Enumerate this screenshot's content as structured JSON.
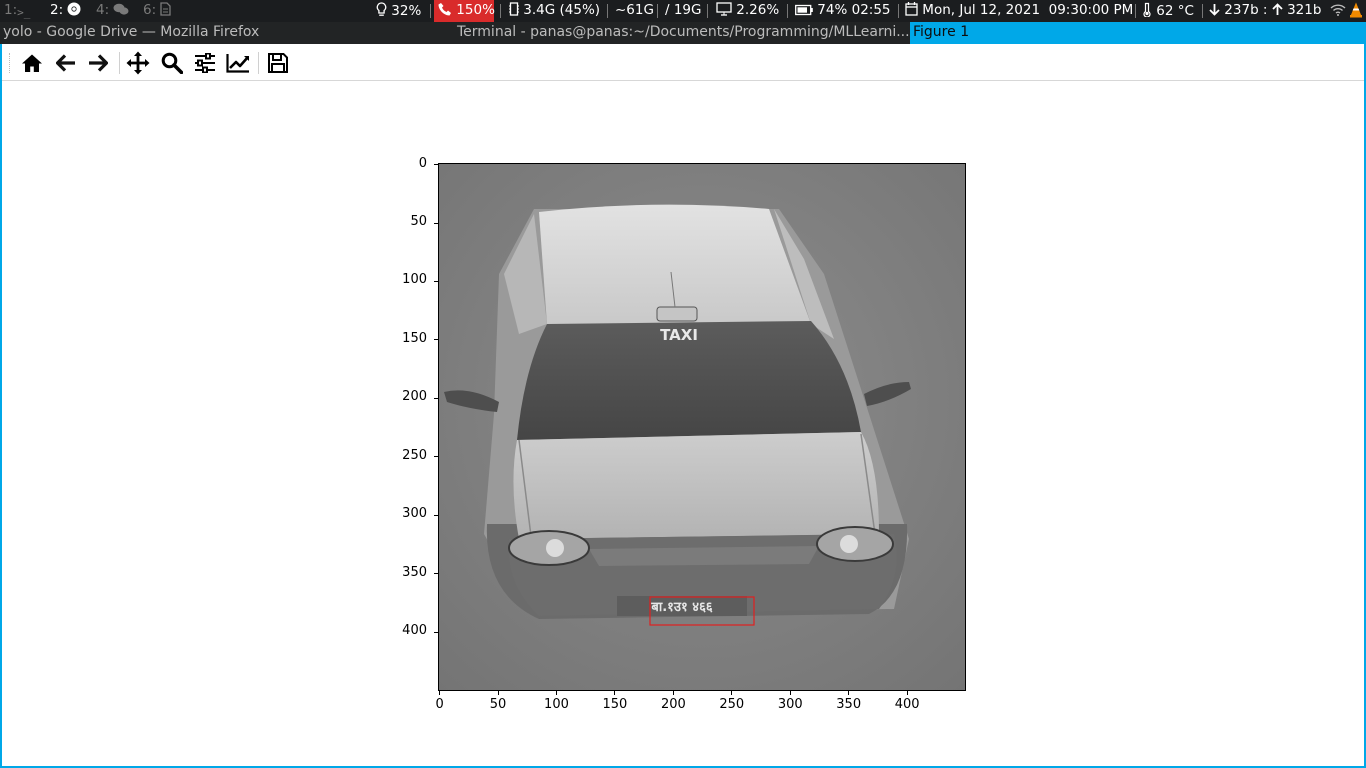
{
  "statusbar": {
    "workspaces": [
      {
        "label": "1:",
        "icon": "terminal-icon",
        "active": false
      },
      {
        "label": "2:",
        "icon": "chrome-icon",
        "active": true
      },
      {
        "label": "4:",
        "icon": "chat-icon",
        "active": false
      },
      {
        "label": "6:",
        "icon": "document-icon",
        "active": false
      }
    ],
    "brightness": "32%",
    "volume": "150%",
    "memory": "3.4G (45%)",
    "disk_used": "~61G",
    "disk_free": "/ 19G",
    "cpu": "2.26%",
    "battery_pct": "74%",
    "battery_time": "02:55",
    "datetime": "Mon, Jul 12, 2021  09:30:00 PM",
    "temperature": "62 °C",
    "net_down": "237b :",
    "net_up": "321b",
    "colors": {
      "background": "#1b1d1f",
      "alert": "#d92b2b",
      "accent": "#00a8e8"
    }
  },
  "titlebar": {
    "windows": [
      "yolo - Google Drive — Mozilla Firefox",
      "Terminal - panas@panas:~/Documents/Programming/MLLearni...",
      "Figure 1"
    ]
  },
  "toolbar": {
    "buttons": [
      {
        "name": "home",
        "icon": "home-icon"
      },
      {
        "name": "back",
        "icon": "arrow-left-icon"
      },
      {
        "name": "forward",
        "icon": "arrow-right-icon"
      },
      {
        "name": "pan",
        "icon": "move-icon"
      },
      {
        "name": "zoom",
        "icon": "zoom-icon"
      },
      {
        "name": "configure-subplots",
        "icon": "sliders-icon"
      },
      {
        "name": "edit-axis",
        "icon": "line-chart-icon"
      },
      {
        "name": "save",
        "icon": "save-icon"
      }
    ]
  },
  "plot": {
    "x_ticks": [
      "0",
      "50",
      "100",
      "150",
      "200",
      "250",
      "300",
      "350",
      "400"
    ],
    "y_ticks": [
      "0",
      "50",
      "100",
      "150",
      "200",
      "250",
      "300",
      "350",
      "400"
    ],
    "image_description": "grayscale image of a taxi car",
    "roof_sign": "TAXI",
    "plate_text": "बा.१उ१ ४६६",
    "bbox_color": "#e02020"
  }
}
